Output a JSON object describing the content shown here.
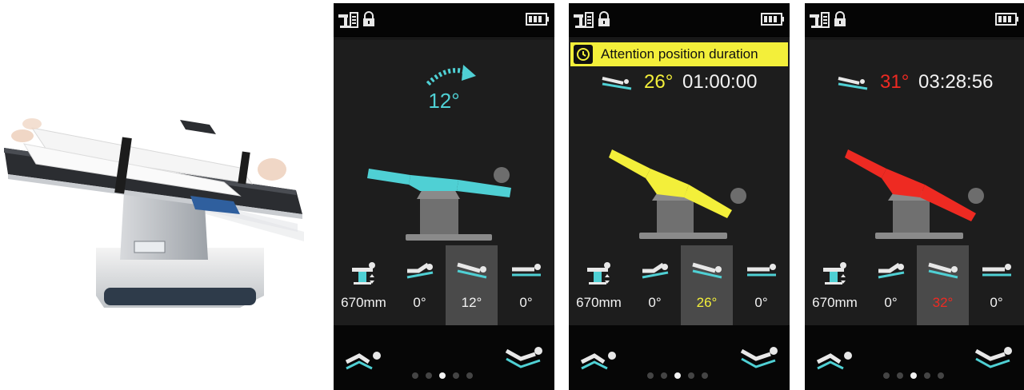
{
  "colors": {
    "normal": "#4fd0d4",
    "attention": "#f3ef3a",
    "alarm": "#ee2a22",
    "text": "#f2f2f2"
  },
  "icons": {
    "status_table": "table-height-icon",
    "status_lock": "lock-icon",
    "status_battery": "battery-icon",
    "ctrl_height": "table-height-icon",
    "ctrl_back": "backrest-icon",
    "ctrl_tilt": "tilt-icon",
    "ctrl_flat": "flat-icon",
    "pos_left": "beach-chair-position-icon",
    "pos_right": "flex-position-icon"
  },
  "screens": [
    {
      "rotation_angle": "12°",
      "controls": [
        {
          "value": "670mm",
          "selected": false
        },
        {
          "value": "0°",
          "selected": false
        },
        {
          "value": "12°",
          "selected": true
        },
        {
          "value": "0°",
          "selected": false
        }
      ],
      "page_dots": 5,
      "active_dot": 2
    },
    {
      "attention_text": "Attention position duration",
      "readout_angle": "26°",
      "readout_time": "01:00:00",
      "controls": [
        {
          "value": "670mm",
          "selected": false
        },
        {
          "value": "0°",
          "selected": false
        },
        {
          "value": "26°",
          "selected": true
        },
        {
          "value": "0°",
          "selected": false
        }
      ],
      "page_dots": 5,
      "active_dot": 2
    },
    {
      "readout_angle": "31°",
      "readout_time": "03:28:56",
      "controls": [
        {
          "value": "670mm",
          "selected": false
        },
        {
          "value": "0°",
          "selected": false
        },
        {
          "value": "32°",
          "selected": true
        },
        {
          "value": "0°",
          "selected": false
        }
      ],
      "page_dots": 5,
      "active_dot": 2
    }
  ]
}
